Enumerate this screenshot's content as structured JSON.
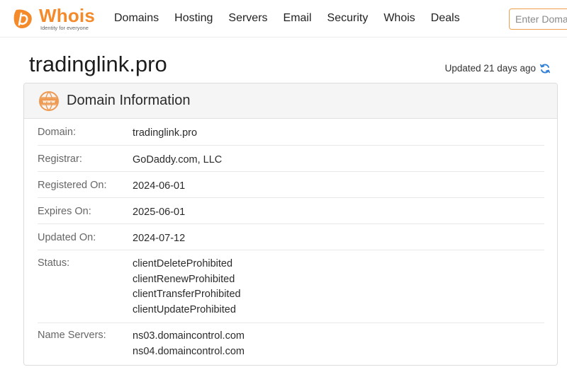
{
  "header": {
    "logo_word": "Whois",
    "logo_tagline": "Identity for everyone",
    "nav": [
      "Domains",
      "Hosting",
      "Servers",
      "Email",
      "Security",
      "Whois",
      "Deals"
    ],
    "search_placeholder": "Enter Domain or IP"
  },
  "page": {
    "title": "tradinglink.pro",
    "updated_text": "Updated 21 days ago"
  },
  "card": {
    "title": "Domain Information",
    "rows": [
      {
        "label": "Domain:",
        "values": [
          "tradinglink.pro"
        ]
      },
      {
        "label": "Registrar:",
        "values": [
          "GoDaddy.com, LLC"
        ]
      },
      {
        "label": "Registered On:",
        "values": [
          "2024-06-01"
        ]
      },
      {
        "label": "Expires On:",
        "values": [
          "2025-06-01"
        ]
      },
      {
        "label": "Updated On:",
        "values": [
          "2024-07-12"
        ]
      },
      {
        "label": "Status:",
        "values": [
          "clientDeleteProhibited",
          "clientRenewProhibited",
          "clientTransferProhibited",
          "clientUpdateProhibited"
        ]
      },
      {
        "label": "Name Servers:",
        "values": [
          "ns03.domaincontrol.com",
          "ns04.domaincontrol.com"
        ]
      }
    ]
  },
  "colors": {
    "brand_orange": "#f58a2b",
    "refresh_blue": "#2f7fd6"
  },
  "icons": {
    "logo": "whois-logo-icon",
    "refresh": "refresh-icon",
    "card": "www-globe-icon"
  }
}
